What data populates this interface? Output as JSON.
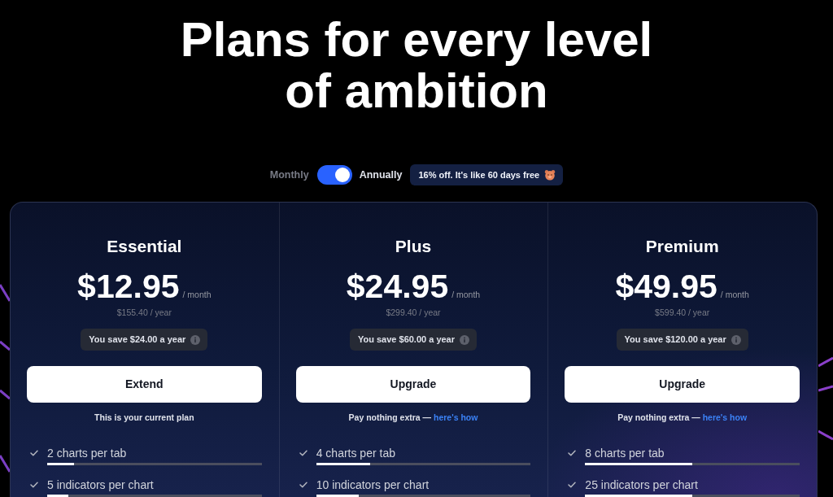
{
  "heading": "Plans for every level of ambition",
  "billing": {
    "options": [
      {
        "label": "Monthly",
        "selected": false
      },
      {
        "label": "Annually",
        "selected": true
      }
    ],
    "discount_badge": "16% off. It's like 60 days free"
  },
  "plans": [
    {
      "name": "Essential",
      "price": "$12.95",
      "period": "/ month",
      "yearly": "$155.40 / year",
      "savings": "You save $24.00 a year",
      "button": "Extend",
      "note": {
        "text": "This is your current plan"
      },
      "features": [
        {
          "label": "2 charts per tab",
          "level": 0.125
        },
        {
          "label": "5 indicators per chart",
          "level": 0.1
        }
      ]
    },
    {
      "name": "Plus",
      "price": "$24.95",
      "period": "/ month",
      "yearly": "$299.40 / year",
      "savings": "You save $60.00 a year",
      "button": "Upgrade",
      "note": {
        "text": "Pay nothing extra —",
        "link": "here's how"
      },
      "features": [
        {
          "label": "4 charts per tab",
          "level": 0.25
        },
        {
          "label": "10 indicators per chart",
          "level": 0.2
        }
      ]
    },
    {
      "name": "Premium",
      "price": "$49.95",
      "period": "/ month",
      "yearly": "$599.40 / year",
      "savings": "You save $120.00 a year",
      "button": "Upgrade",
      "note": {
        "text": "Pay nothing extra —",
        "link": "here's how"
      },
      "features": [
        {
          "label": "8 charts per tab",
          "level": 0.5
        },
        {
          "label": "25 indicators per chart",
          "level": 0.5
        }
      ]
    }
  ]
}
